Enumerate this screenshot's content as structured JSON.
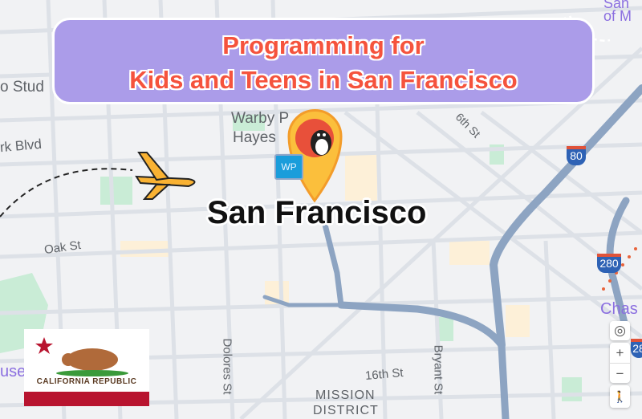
{
  "banner": {
    "title_line1": "Programming for",
    "title_line2": "Kids and Teens in San Francisco"
  },
  "city_label": "San Francisco",
  "map_labels": {
    "studio": "o Stud",
    "blvd": "rk Blvd",
    "warby": "Warby P",
    "hayes": "Hayes",
    "sixth": "6th St",
    "oak": "Oak St",
    "dolores": "Dolores St",
    "bryant": "Bryant St",
    "sixteenth": "16th St",
    "mission1": "MISSION",
    "mission2": "DISTRICT",
    "use": "use",
    "chase": "Chas",
    "sfmoma1": "San",
    "sfmoma2": "of M",
    "wp_badge": "WP",
    "i80": "80",
    "i280": "280",
    "i280b": "28"
  },
  "flag": {
    "text": "CALIFORNIA  REPUBLIC"
  },
  "map_controls": {
    "zoom_in": "+",
    "zoom_out": "−",
    "locate": "◎",
    "pegman": "🚶"
  },
  "icons": [
    "globe-icon",
    "airplane-icon",
    "penguin-location-pin-icon",
    "california-flag",
    "dashed-arrow-icon"
  ],
  "colors": {
    "banner": "#ab9ce9",
    "title": "#f5533d",
    "pin": "#fbbf3c",
    "highway": "#8da4c2",
    "flag_stripe": "#b8142f"
  }
}
